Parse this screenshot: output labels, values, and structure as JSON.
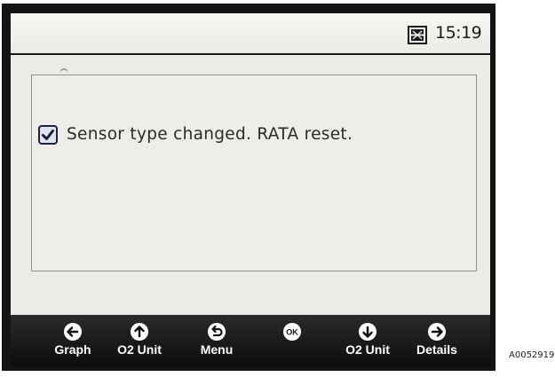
{
  "status": {
    "time": "15:19",
    "icon": "device-status-icon"
  },
  "message": {
    "text": "Sensor type changed. RATA reset.",
    "icon": "checkbox-checked-icon"
  },
  "softkeys": [
    {
      "label": "Graph",
      "icon": "arrow-left-icon"
    },
    {
      "label": "O2 Unit",
      "icon": "arrow-up-icon"
    },
    {
      "label": "Menu",
      "icon": "back-icon"
    },
    {
      "label": "",
      "icon": "ok-icon",
      "icon_text": "OK"
    },
    {
      "label": "O2 Unit",
      "icon": "arrow-down-icon"
    },
    {
      "label": "Details",
      "icon": "arrow-right-icon"
    }
  ],
  "figure_id": "A0052919",
  "colors": {
    "bezel": "#141414",
    "screen": "#ecebe6",
    "softkey_bar": "#1a1a1a",
    "text": "#2a2a2a"
  }
}
